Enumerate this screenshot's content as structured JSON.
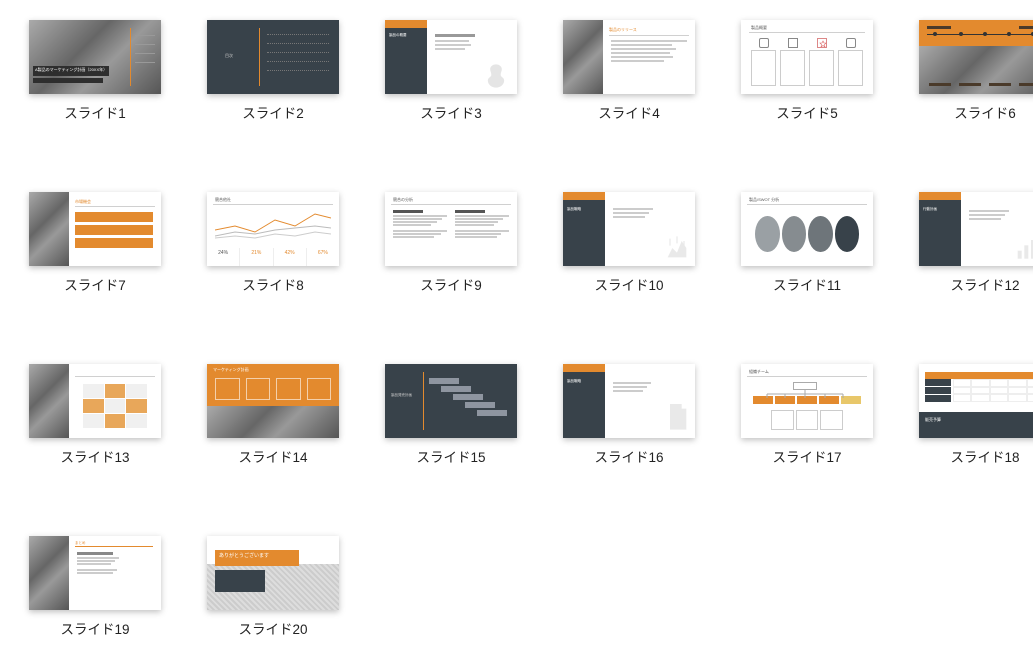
{
  "slides": [
    {
      "label": "スライド1",
      "title_text": "A製品のマーケティング計画（20XX年）"
    },
    {
      "label": "スライド2",
      "title_text": "目次"
    },
    {
      "label": "スライド3",
      "title_text": "製品の概要"
    },
    {
      "label": "スライド4",
      "title_text": "製品のリリース"
    },
    {
      "label": "スライド5",
      "title_text": "製品概要"
    },
    {
      "label": "スライド6",
      "title_text": ""
    },
    {
      "label": "スライド7",
      "title_text": ""
    },
    {
      "label": "スライド8",
      "title_text": "競合他社"
    },
    {
      "label": "スライド9",
      "title_text": "競合の分析"
    },
    {
      "label": "スライド10",
      "title_text": "製品戦略"
    },
    {
      "label": "スライド11",
      "title_text": "製品/SWOT 分析"
    },
    {
      "label": "スライド12",
      "title_text": "行動計画"
    },
    {
      "label": "スライド13",
      "title_text": ""
    },
    {
      "label": "スライド14",
      "title_text": "マーケティング計画"
    },
    {
      "label": "スライド15",
      "title_text": "製品発売計画"
    },
    {
      "label": "スライド16",
      "title_text": "製品戦略"
    },
    {
      "label": "スライド17",
      "title_text": "組織チーム"
    },
    {
      "label": "スライド18",
      "title_text": "販売予算"
    },
    {
      "label": "スライド19",
      "title_text": ""
    },
    {
      "label": "スライド20",
      "title_text": "ありがとうございます"
    }
  ],
  "colors": {
    "accent_orange": "#e38a2e",
    "dark_slate": "#38424a",
    "light_gray": "#d0d0d0"
  }
}
